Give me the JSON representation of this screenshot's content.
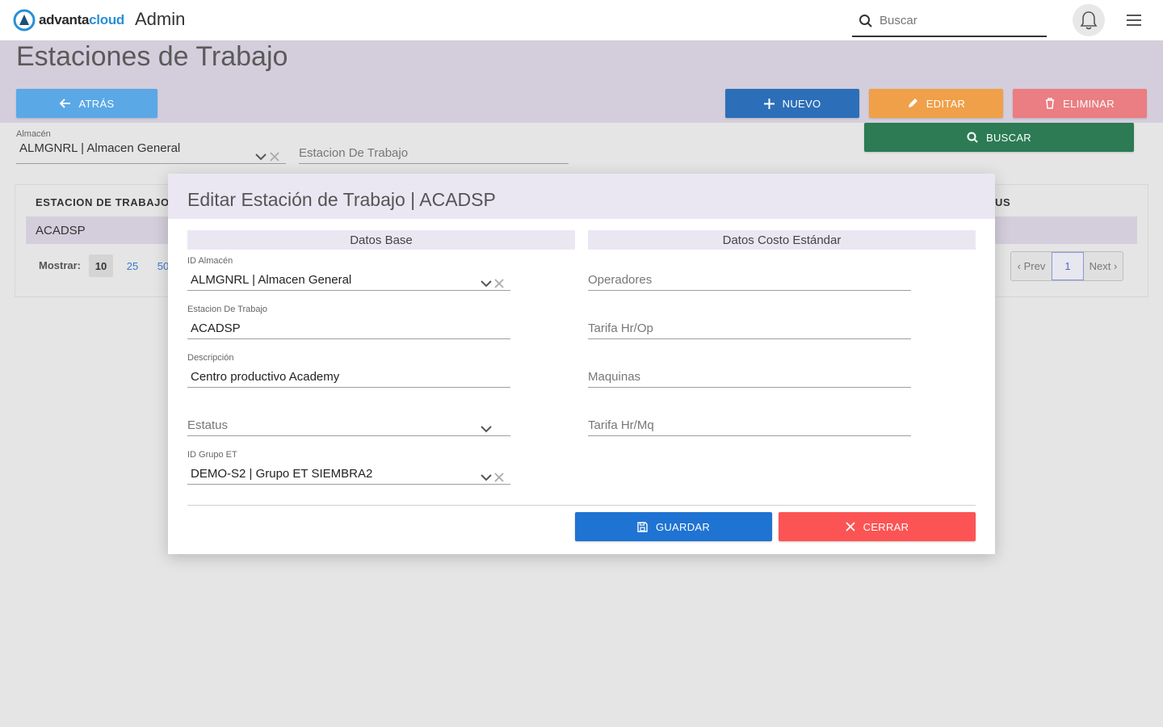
{
  "header": {
    "logo_prefix": "advanta",
    "logo_suffix": "cloud",
    "app_title": "Admin",
    "search_placeholder": "Buscar"
  },
  "page": {
    "title": "Estaciones de Trabajo",
    "buttons": {
      "back": "ATRÁS",
      "new": "NUEVO",
      "edit": "EDITAR",
      "delete": "ELIMINAR",
      "search": "BUSCAR"
    },
    "filters": {
      "almacen_label": "Almacén",
      "almacen_value": "ALMGNRL | Almacen General",
      "estacion_placeholder": "Estacion De Trabajo"
    },
    "table": {
      "col_estacion": "ESTACION DE TRABAJO",
      "col_estatus_partial": "US",
      "rows": [
        {
          "estacion": "ACADSP"
        }
      ],
      "show_label": "Mostrar:",
      "show_options": [
        "10",
        "25",
        "50"
      ],
      "pager": {
        "prev": "‹ Prev",
        "current": "1",
        "next": "Next ›"
      }
    }
  },
  "modal": {
    "title": "Editar Estación de Trabajo | ACADSP",
    "section_base": "Datos Base",
    "section_cost": "Datos Costo Estándar",
    "fields": {
      "id_almacen_label": "ID Almacén",
      "id_almacen_value": "ALMGNRL | Almacen General",
      "estacion_label": "Estacion De Trabajo",
      "estacion_value": "ACADSP",
      "descripcion_label": "Descripción",
      "descripcion_value": "Centro productivo Academy",
      "estatus_placeholder": "Estatus",
      "grupo_label": "ID Grupo ET",
      "grupo_value": "DEMO-S2 | Grupo ET SIEMBRA2",
      "operadores_placeholder": "Operadores",
      "tarifa_op_placeholder": "Tarifa Hr/Op",
      "maquinas_placeholder": "Maquinas",
      "tarifa_mq_placeholder": "Tarifa Hr/Mq"
    },
    "buttons": {
      "save": "GUARDAR",
      "close": "CERRAR"
    }
  },
  "colors": {
    "overlay_band": "#d4cedc",
    "primary": "#1f73d2",
    "danger": "#fc5454",
    "success": "#2c7b55",
    "warning": "#f0a048"
  }
}
